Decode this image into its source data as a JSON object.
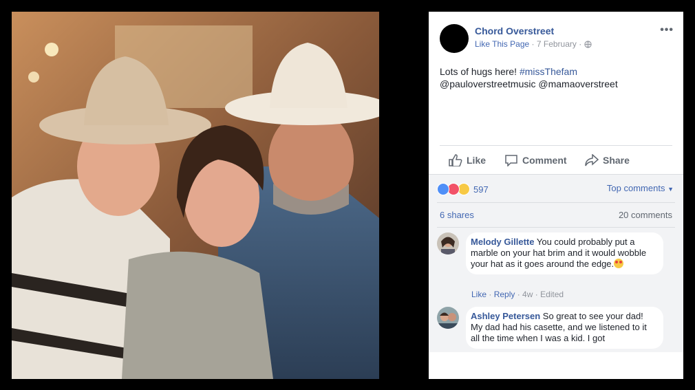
{
  "post": {
    "page_name": "Chord Overstreet",
    "like_page": "Like This Page",
    "date": "7 February",
    "separator": "·",
    "options": "•••",
    "text_plain": "Lots of hugs here! ",
    "hashtag": "#missThefam",
    "mentions": "@pauloverstreetmusic @mamaoverstreet"
  },
  "actions": {
    "like": "Like",
    "comment": "Comment",
    "share": "Share"
  },
  "stats": {
    "reactions_count": "597",
    "top_comments": "Top comments",
    "shares": "6 shares",
    "comments": "20 comments"
  },
  "comments": [
    {
      "name": "Melody Gillette",
      "text": "You could probably put a marble on your hat brim and it would wobble your hat as it goes around the edge.",
      "like": "Like",
      "reply": "Reply",
      "age": "4w",
      "edited": "Edited"
    },
    {
      "name": "Ashley Petersen",
      "text": "So great to see your dad! My dad had his casette, and we listened to it all the time when I was a kid. I got"
    }
  ],
  "colors": {
    "link": "#365899",
    "accent": "#4267b2",
    "muted": "#90949c"
  }
}
